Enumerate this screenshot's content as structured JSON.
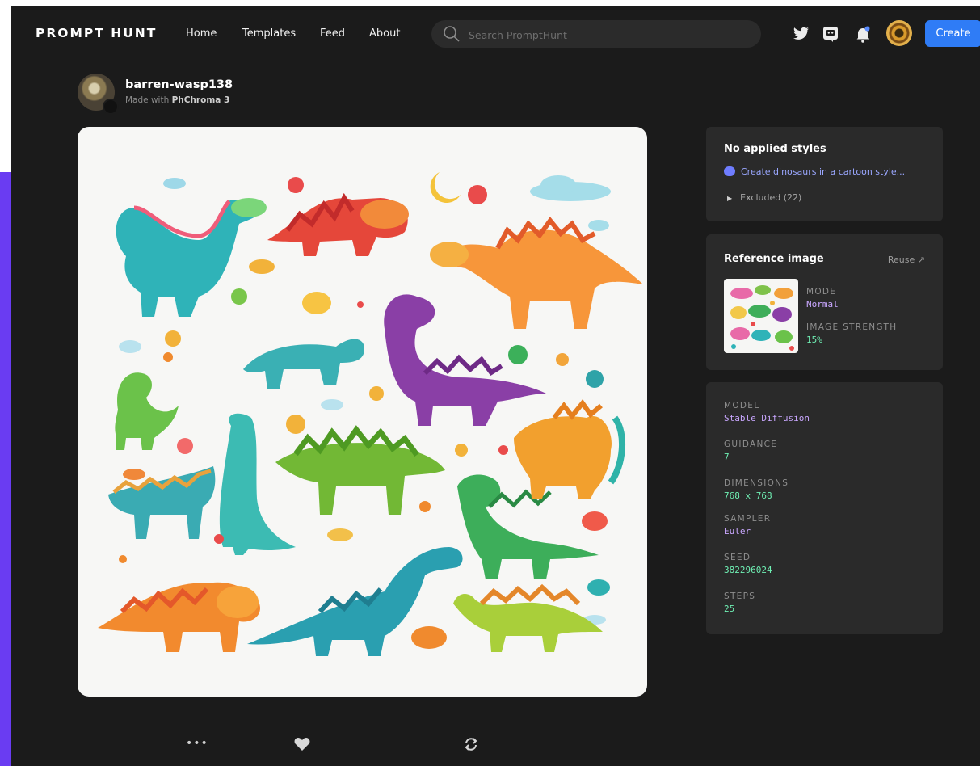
{
  "nav": {
    "brand": "PROMPT HUNT",
    "links": [
      "Home",
      "Templates",
      "Feed",
      "About"
    ],
    "search_placeholder": "Search PromptHunt",
    "icons": [
      "twitter-icon",
      "discord-icon",
      "notification-bell-icon"
    ],
    "create_label": "Create"
  },
  "author": {
    "username": "barren-wasp138",
    "made_with_prefix": "Made with",
    "model_name": "PhChroma 3"
  },
  "styles_panel": {
    "title": "No applied styles",
    "prompt": "Create dinosaurs in a cartoon style...",
    "excluded": "Excluded (22)"
  },
  "reference_panel": {
    "title": "Reference image",
    "reuse": "Reuse ↗",
    "mode_label": "MODE",
    "mode_value": "Normal",
    "strength_label": "IMAGE STRENGTH",
    "strength_value": "15%"
  },
  "settings_panel": {
    "model_label": "MODEL",
    "model_value": "Stable Diffusion",
    "guidance_label": "GUIDANCE",
    "guidance_value": "7",
    "dimensions_label": "DIMENSIONS",
    "dimensions_value": "768 x 768",
    "sampler_label": "SAMPLER",
    "sampler_value": "Euler",
    "seed_label": "SEED",
    "seed_value": "382296024",
    "steps_label": "STEPS",
    "steps_value": "25"
  },
  "actions": {
    "more": "•••",
    "icons": [
      "more-icon",
      "heart-icon",
      "remix-icon"
    ]
  },
  "colors": {
    "background": "#1b1b1b",
    "panel": "#2a2a2a",
    "accent_blue": "#2f7cf6",
    "value_purple": "#c9a7ff",
    "value_green": "#6ff0b4",
    "prompt_link": "#9aa7ff"
  }
}
